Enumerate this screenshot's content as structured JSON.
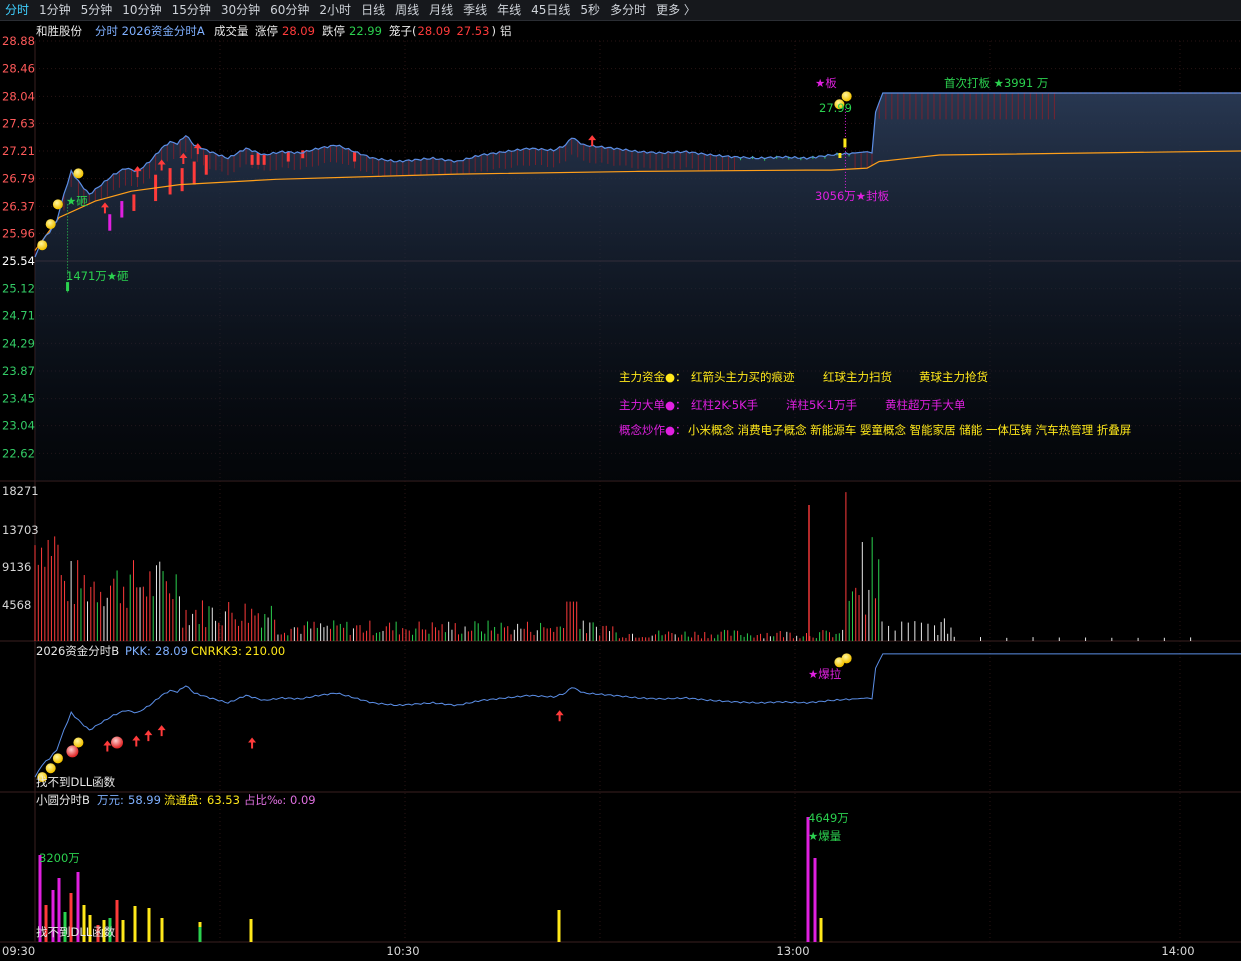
{
  "toolbar": {
    "items": [
      "分时",
      "1分钟",
      "5分钟",
      "10分钟",
      "15分钟",
      "30分钟",
      "60分钟",
      "2小时",
      "日线",
      "周线",
      "月线",
      "季线",
      "年线",
      "45日线",
      "5秒",
      "多分时",
      "更多 〉"
    ],
    "active_index": 0
  },
  "header": {
    "stock_name": "和胜股份",
    "indicator": "分时 2026资金分时A",
    "volume_label": "成交量",
    "limit_up_label": "涨停",
    "limit_up_value": "28.09",
    "limit_down_label": "跌停",
    "limit_down_value": "22.99",
    "cage_label": "笼子(",
    "cage_high": "28.09",
    "cage_low": "27.53",
    "cage_close": ")",
    "extra": "铝"
  },
  "price_axis": [
    "28.88",
    "28.46",
    "28.04",
    "27.63",
    "27.21",
    "26.79",
    "26.37",
    "25.96",
    "25.54",
    "25.12",
    "24.71",
    "24.29",
    "23.87",
    "23.45",
    "23.04",
    "22.62"
  ],
  "prev_close": "25.54",
  "volume_axis": [
    "18271",
    "13703",
    "9136",
    "4568"
  ],
  "time_axis": [
    "09:30",
    "10:30",
    "13:00",
    "14:00"
  ],
  "annotations": {
    "first_board": "首次打板 ★3991 万",
    "board_star": "★板",
    "board_price": "27.99",
    "seal_board": "3056万★封板",
    "smash_top": "★砸",
    "smash_bottom": "1471万★砸",
    "burst_pull": "★爆拉",
    "big_amount": "4649万",
    "burst_volume": "★爆量",
    "early_amount": "3200万"
  },
  "legend": {
    "main_fund_label": "主力资金●：",
    "main_fund_items": [
      "红箭头主力买的痕迹",
      "红球主力扫货",
      "黄球主力抢货"
    ],
    "big_order_label": "主力大单●：",
    "big_order_items": [
      "红柱2K-5K手",
      "洋柱5K-1万手",
      "黄柱超万手大单"
    ],
    "concept_label": "概念炒作●：",
    "concept_items": "小米概念 消费电子概念 新能源车 婴童概念 智能家居 储能 一体压铸 汽车热管理 折叠屏"
  },
  "panel2": {
    "title": "2026资金分时B",
    "pkk_label": "PKK:",
    "pkk_value": "28.09",
    "cnrkk_label": "CNRKK3:",
    "cnrkk_value": "210.00",
    "dll_text": "找不到DLL函数"
  },
  "panel3": {
    "title": "小圆分时B",
    "wan_label": "万元:",
    "wan_value": "58.99",
    "float_label": "流通盘:",
    "float_value": "63.53",
    "ratio_label": "占比‰:",
    "ratio_value": "0.09",
    "dll_text": "找不到DLL函数"
  },
  "colors": {
    "up": "#ff3b3b",
    "down": "#2bd14f",
    "price_line": "#5b8ee6",
    "avg_line": "#ff9f1a",
    "magenta": "#e020e0",
    "yellow": "#ffe81a",
    "text_axis_up": "#ff5a5a",
    "text_axis_down": "#33cc66"
  }
}
